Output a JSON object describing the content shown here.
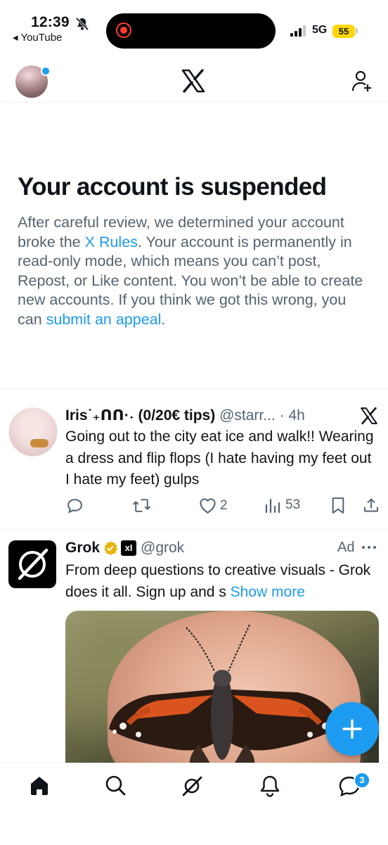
{
  "status_bar": {
    "time": "12:39",
    "back_app": "YouTube",
    "network": "5G",
    "battery": "55",
    "icons": [
      "bell-slash-icon",
      "record-icon",
      "signal-icon"
    ]
  },
  "nav": {
    "logo": "X",
    "icons": [
      "avatar",
      "x-logo-icon",
      "add-user-icon"
    ]
  },
  "notice": {
    "title": "Your account is suspended",
    "body_1": "After careful review, we determined your account broke the ",
    "link_rules": "X Rules",
    "body_2": ". Your account is permanently in read-only mode, which means you can’t post, Repost, or Like content. You won’t be able to create new accounts. If you think we got this wrong, you can ",
    "link_appeal": "submit an appeal",
    "body_3": "."
  },
  "tweet1": {
    "name": "Iris˙₊ᑎᑎ·˖ (0/20€ tips)",
    "handle": "@starr...",
    "dot": "·",
    "time": "4h",
    "text": "Going out to the city eat ice and walk!! Wearing a dress and flip flops (I hate having my feet out I hate my feet) gulps",
    "likes": "2",
    "views": "53",
    "icons": [
      "reply-icon",
      "repost-icon",
      "like-icon",
      "views-icon",
      "bookmark-icon",
      "share-icon"
    ]
  },
  "ad": {
    "name": "Grok",
    "badge": "xI",
    "handle": "@grok",
    "label": "Ad",
    "text": "From deep questions to creative visuals - Grok does it all. Sign up and s",
    "show_more": "Show more"
  },
  "tab_bar": {
    "tabs": [
      "home-icon",
      "search-icon",
      "grok-icon",
      "notifications-icon",
      "messages-icon"
    ],
    "messages_badge": "3"
  },
  "colors": {
    "accent": "#1d9bf0",
    "text": "#0f1419",
    "muted": "#536471",
    "battery": "#ffd60a",
    "recording": "#ff3b30"
  }
}
